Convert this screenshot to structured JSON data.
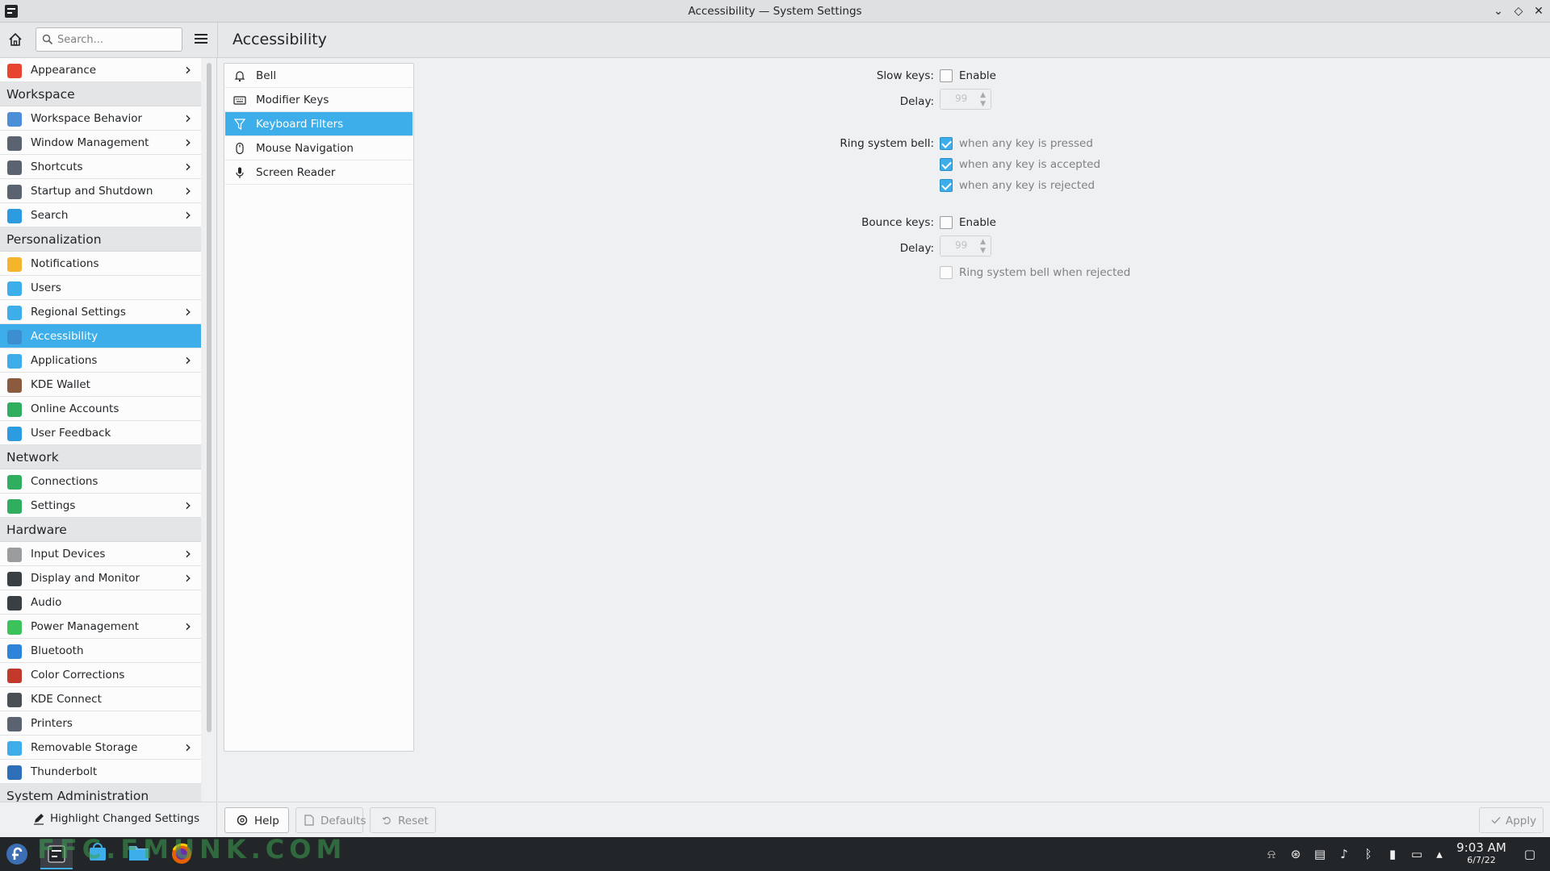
{
  "window": {
    "title": "Accessibility — System Settings",
    "min_glyph": "⌄",
    "max_glyph": "◇",
    "close_glyph": "✕"
  },
  "header": {
    "search_placeholder": "Search...",
    "page_title": "Accessibility"
  },
  "sidebar": {
    "groups": [
      {
        "type": "item",
        "label": "Appearance",
        "chevron": true,
        "icon": "appearance-icon",
        "color": "#e8452f"
      },
      {
        "type": "category",
        "label": "Workspace"
      },
      {
        "type": "item",
        "label": "Workspace Behavior",
        "chevron": true,
        "icon": "workspace-behavior-icon",
        "color": "#4a8fd8"
      },
      {
        "type": "item",
        "label": "Window Management",
        "chevron": true,
        "icon": "window-management-icon",
        "color": "#5b6370"
      },
      {
        "type": "item",
        "label": "Shortcuts",
        "chevron": true,
        "icon": "keyboard-icon",
        "color": "#5b6370"
      },
      {
        "type": "item",
        "label": "Startup and Shutdown",
        "chevron": true,
        "icon": "startup-icon",
        "color": "#5b6370"
      },
      {
        "type": "item",
        "label": "Search",
        "chevron": true,
        "icon": "search-icon",
        "color": "#2d9be0"
      },
      {
        "type": "category",
        "label": "Personalization"
      },
      {
        "type": "item",
        "label": "Notifications",
        "chevron": false,
        "icon": "bell-icon",
        "color": "#f4b52c"
      },
      {
        "type": "item",
        "label": "Users",
        "chevron": false,
        "icon": "users-icon",
        "color": "#3daee9"
      },
      {
        "type": "item",
        "label": "Regional Settings",
        "chevron": true,
        "icon": "regional-icon",
        "color": "#3daee9"
      },
      {
        "type": "item",
        "label": "Accessibility",
        "chevron": false,
        "icon": "accessibility-icon",
        "color": "#3b8fd1",
        "selected": true
      },
      {
        "type": "item",
        "label": "Applications",
        "chevron": true,
        "icon": "applications-icon",
        "color": "#3daee9"
      },
      {
        "type": "item",
        "label": "KDE Wallet",
        "chevron": false,
        "icon": "wallet-icon",
        "color": "#8a5b3e"
      },
      {
        "type": "item",
        "label": "Online Accounts",
        "chevron": false,
        "icon": "online-accounts-icon",
        "color": "#2fae5f"
      },
      {
        "type": "item",
        "label": "User Feedback",
        "chevron": false,
        "icon": "feedback-icon",
        "color": "#2d9be0"
      },
      {
        "type": "category",
        "label": "Network"
      },
      {
        "type": "item",
        "label": "Connections",
        "chevron": false,
        "icon": "globe-icon",
        "color": "#2fae5f"
      },
      {
        "type": "item",
        "label": "Settings",
        "chevron": true,
        "icon": "network-settings-icon",
        "color": "#2fae5f"
      },
      {
        "type": "category",
        "label": "Hardware"
      },
      {
        "type": "item",
        "label": "Input Devices",
        "chevron": true,
        "icon": "mouse-icon",
        "color": "#9a9c9e"
      },
      {
        "type": "item",
        "label": "Display and Monitor",
        "chevron": true,
        "icon": "monitor-icon",
        "color": "#3a3f44"
      },
      {
        "type": "item",
        "label": "Audio",
        "chevron": false,
        "icon": "speaker-icon",
        "color": "#3a3f44"
      },
      {
        "type": "item",
        "label": "Power Management",
        "chevron": true,
        "icon": "power-icon",
        "color": "#3cc25a"
      },
      {
        "type": "item",
        "label": "Bluetooth",
        "chevron": false,
        "icon": "bluetooth-icon",
        "color": "#2d84d8"
      },
      {
        "type": "item",
        "label": "Color Corrections",
        "chevron": false,
        "icon": "color-wheel-icon",
        "color": "#c2392b"
      },
      {
        "type": "item",
        "label": "KDE Connect",
        "chevron": false,
        "icon": "phone-icon",
        "color": "#4a4f55"
      },
      {
        "type": "item",
        "label": "Printers",
        "chevron": false,
        "icon": "printer-icon",
        "color": "#5b6370"
      },
      {
        "type": "item",
        "label": "Removable Storage",
        "chevron": true,
        "icon": "usb-icon",
        "color": "#3daee9"
      },
      {
        "type": "item",
        "label": "Thunderbolt",
        "chevron": false,
        "icon": "thunderbolt-icon",
        "color": "#2d6fb8"
      },
      {
        "type": "category",
        "label": "System Administration"
      }
    ],
    "highlight_label": "Highlight Changed Settings"
  },
  "subpanel": {
    "items": [
      {
        "label": "Bell",
        "icon": "bell-outline-icon"
      },
      {
        "label": "Modifier Keys",
        "icon": "keyboard-outline-icon"
      },
      {
        "label": "Keyboard Filters",
        "icon": "filter-icon",
        "selected": true
      },
      {
        "label": "Mouse Navigation",
        "icon": "mouse-outline-icon"
      },
      {
        "label": "Screen Reader",
        "icon": "microphone-icon"
      }
    ]
  },
  "form": {
    "slow_keys_label": "Slow keys:",
    "slow_keys_enable": "Enable",
    "slow_keys_checked": false,
    "delay_label": "Delay:",
    "slow_delay_value": "99",
    "ring_bell_label": "Ring system bell:",
    "ring_pressed": "when any key is pressed",
    "ring_accepted": "when any key is accepted",
    "ring_rejected": "when any key is rejected",
    "bounce_keys_label": "Bounce keys:",
    "bounce_keys_enable": "Enable",
    "bounce_delay_value": "99",
    "bounce_ring_label": "Ring system bell when rejected"
  },
  "buttons": {
    "help": "Help",
    "defaults": "Defaults",
    "reset": "Reset",
    "apply": "Apply"
  },
  "taskbar": {
    "time": "9:03 AM",
    "date": "6/7/22",
    "watermark": "FFC.FMUNK.COM"
  },
  "colors": {
    "accent": "#3daee9",
    "taskbar": "#232629"
  }
}
